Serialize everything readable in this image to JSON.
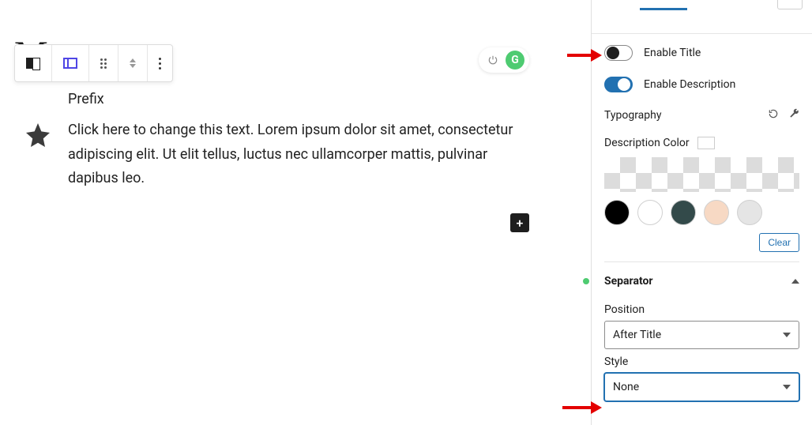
{
  "canvas": {
    "bg_title": "M            t",
    "prefix_label": "Prefix",
    "description_text": "Click here to change this text. Lorem ipsum dolor sit amet, consectetur adipiscing elit. Ut elit tellus, luctus nec ullamcorper mattis, pulvinar dapibus leo.",
    "status_g": "G",
    "add_symbol": "+"
  },
  "sidebar": {
    "enable_title_label": "Enable Title",
    "enable_title_on": false,
    "enable_description_label": "Enable Description",
    "enable_description_on": true,
    "typography_label": "Typography",
    "description_color_label": "Description Color",
    "swatches": [
      "#000000",
      "#ffffff",
      "#334a4a",
      "#f7d9c4",
      "#e5e5e5"
    ],
    "clear_label": "Clear",
    "separator": {
      "title": "Separator",
      "position_label": "Position",
      "position_value": "After Title",
      "style_label": "Style",
      "style_value": "None"
    }
  }
}
